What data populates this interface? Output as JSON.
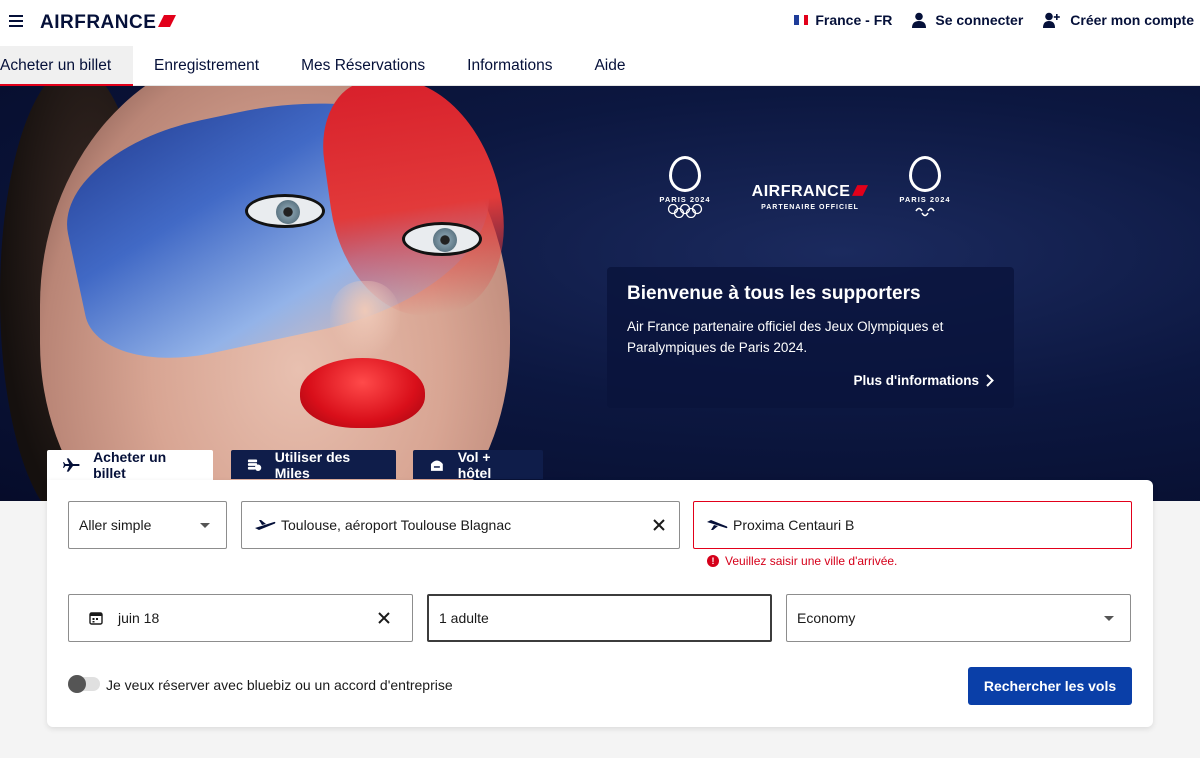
{
  "header": {
    "logo": "AIRFRANCE",
    "locale": "France - FR",
    "login": "Se connecter",
    "signup": "Créer mon compte"
  },
  "nav": {
    "tabs": [
      {
        "label": "Acheter un billet",
        "active": true
      },
      {
        "label": "Enregistrement"
      },
      {
        "label": "Mes Réservations"
      },
      {
        "label": "Informations"
      },
      {
        "label": "Aide"
      }
    ]
  },
  "hero": {
    "partners": {
      "left_logo": "PARIS 2024",
      "brand": "AIRFRANCE",
      "brand_sub": "PARTENAIRE OFFICIEL",
      "right_logo": "PARIS 2024"
    },
    "promo": {
      "title": "Bienvenue à tous les supporters",
      "text": "Air France partenaire officiel des Jeux Olympiques et Paralympiques de Paris 2024.",
      "link": "Plus d'informations"
    }
  },
  "booking": {
    "tabs": [
      {
        "label": "Acheter un billet",
        "icon": "plane-icon",
        "active": true
      },
      {
        "label": "Utiliser des Miles",
        "icon": "miles-icon"
      },
      {
        "label": "Vol + hôtel",
        "icon": "hotel-icon"
      }
    ],
    "trip_type": "Aller simple",
    "origin": "Toulouse, aéroport Toulouse Blagnac",
    "destination": "Proxima Centauri B",
    "destination_error": "Veuillez saisir une ville d'arrivée.",
    "date": "juin 18",
    "passengers": "1 adulte",
    "cabin": "Economy",
    "bluebiz_label": "Je veux réserver avec bluebiz ou un accord d'entreprise",
    "search_label": "Rechercher les vols"
  },
  "colors": {
    "brand_navy": "#051039",
    "accent_red": "#e2001a",
    "cta_blue": "#0a3fa8"
  }
}
